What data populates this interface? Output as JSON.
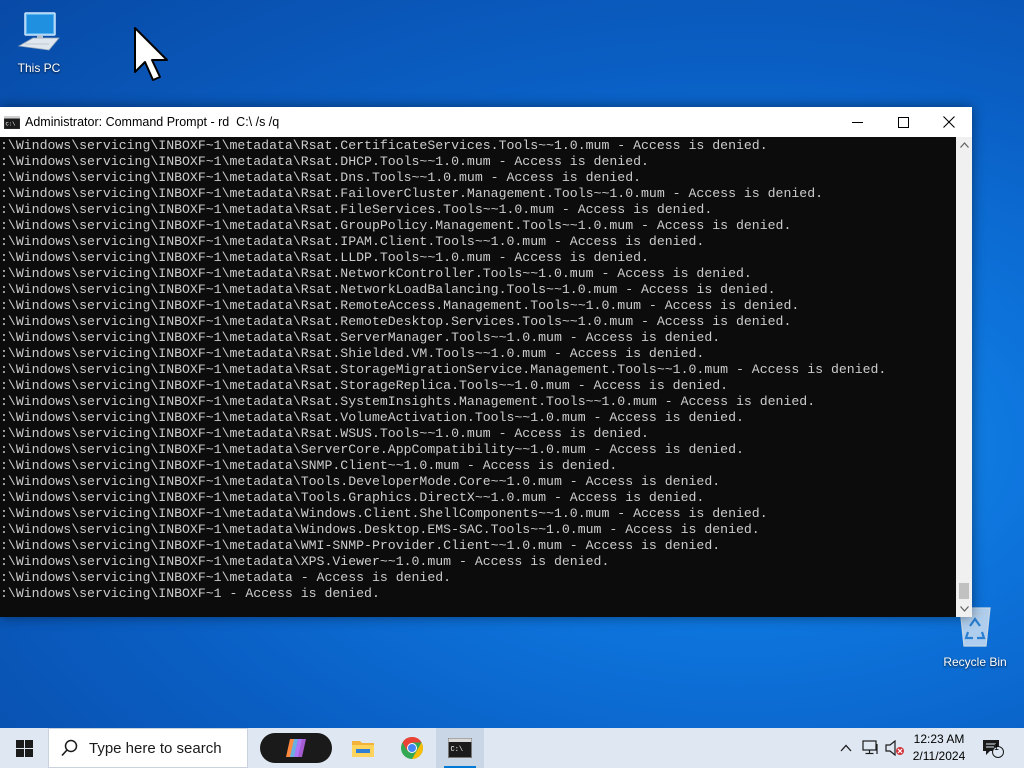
{
  "desktop": {
    "icons": [
      {
        "label": "This PC",
        "icon": "computer-icon"
      },
      {
        "label": "Recycle Bin",
        "icon": "recycle-bin-icon"
      }
    ]
  },
  "window": {
    "title": "Administrator: Command Prompt - rd  C:\\ /s /q",
    "icon": "cmd-icon",
    "buttons": [
      "minimize-icon",
      "maximize-icon",
      "close-icon"
    ]
  },
  "console": {
    "lines": [
      ":\\Windows\\servicing\\INBOXF~1\\metadata\\Rsat.CertificateServices.Tools~~1.0.mum - Access is denied.",
      ":\\Windows\\servicing\\INBOXF~1\\metadata\\Rsat.DHCP.Tools~~1.0.mum - Access is denied.",
      ":\\Windows\\servicing\\INBOXF~1\\metadata\\Rsat.Dns.Tools~~1.0.mum - Access is denied.",
      ":\\Windows\\servicing\\INBOXF~1\\metadata\\Rsat.FailoverCluster.Management.Tools~~1.0.mum - Access is denied.",
      ":\\Windows\\servicing\\INBOXF~1\\metadata\\Rsat.FileServices.Tools~~1.0.mum - Access is denied.",
      ":\\Windows\\servicing\\INBOXF~1\\metadata\\Rsat.GroupPolicy.Management.Tools~~1.0.mum - Access is denied.",
      ":\\Windows\\servicing\\INBOXF~1\\metadata\\Rsat.IPAM.Client.Tools~~1.0.mum - Access is denied.",
      ":\\Windows\\servicing\\INBOXF~1\\metadata\\Rsat.LLDP.Tools~~1.0.mum - Access is denied.",
      ":\\Windows\\servicing\\INBOXF~1\\metadata\\Rsat.NetworkController.Tools~~1.0.mum - Access is denied.",
      ":\\Windows\\servicing\\INBOXF~1\\metadata\\Rsat.NetworkLoadBalancing.Tools~~1.0.mum - Access is denied.",
      ":\\Windows\\servicing\\INBOXF~1\\metadata\\Rsat.RemoteAccess.Management.Tools~~1.0.mum - Access is denied.",
      ":\\Windows\\servicing\\INBOXF~1\\metadata\\Rsat.RemoteDesktop.Services.Tools~~1.0.mum - Access is denied.",
      ":\\Windows\\servicing\\INBOXF~1\\metadata\\Rsat.ServerManager.Tools~~1.0.mum - Access is denied.",
      ":\\Windows\\servicing\\INBOXF~1\\metadata\\Rsat.Shielded.VM.Tools~~1.0.mum - Access is denied.",
      ":\\Windows\\servicing\\INBOXF~1\\metadata\\Rsat.StorageMigrationService.Management.Tools~~1.0.mum - Access is denied.",
      ":\\Windows\\servicing\\INBOXF~1\\metadata\\Rsat.StorageReplica.Tools~~1.0.mum - Access is denied.",
      ":\\Windows\\servicing\\INBOXF~1\\metadata\\Rsat.SystemInsights.Management.Tools~~1.0.mum - Access is denied.",
      ":\\Windows\\servicing\\INBOXF~1\\metadata\\Rsat.VolumeActivation.Tools~~1.0.mum - Access is denied.",
      ":\\Windows\\servicing\\INBOXF~1\\metadata\\Rsat.WSUS.Tools~~1.0.mum - Access is denied.",
      ":\\Windows\\servicing\\INBOXF~1\\metadata\\ServerCore.AppCompatibility~~1.0.mum - Access is denied.",
      ":\\Windows\\servicing\\INBOXF~1\\metadata\\SNMP.Client~~1.0.mum - Access is denied.",
      ":\\Windows\\servicing\\INBOXF~1\\metadata\\Tools.DeveloperMode.Core~~1.0.mum - Access is denied.",
      ":\\Windows\\servicing\\INBOXF~1\\metadata\\Tools.Graphics.DirectX~~1.0.mum - Access is denied.",
      ":\\Windows\\servicing\\INBOXF~1\\metadata\\Windows.Client.ShellComponents~~1.0.mum - Access is denied.",
      ":\\Windows\\servicing\\INBOXF~1\\metadata\\Windows.Desktop.EMS-SAC.Tools~~1.0.mum - Access is denied.",
      ":\\Windows\\servicing\\INBOXF~1\\metadata\\WMI-SNMP-Provider.Client~~1.0.mum - Access is denied.",
      ":\\Windows\\servicing\\INBOXF~1\\metadata\\XPS.Viewer~~1.0.mum - Access is denied.",
      ":\\Windows\\servicing\\INBOXF~1\\metadata - Access is denied.",
      ":\\Windows\\servicing\\INBOXF~1 - Access is denied."
    ],
    "text_color": "#cccccc",
    "background": "#0c0c0c"
  },
  "taskbar": {
    "search_placeholder": "Type here to search",
    "pinned": [
      "copilot-icon",
      "file-explorer-icon",
      "chrome-icon",
      "command-prompt-icon"
    ],
    "tray": [
      "chevron-up-icon",
      "network-icon",
      "volume-muted-icon"
    ],
    "time": "12:23 AM",
    "date": "2/11/2024",
    "notification_count": "1",
    "accent": "#0078d4"
  }
}
